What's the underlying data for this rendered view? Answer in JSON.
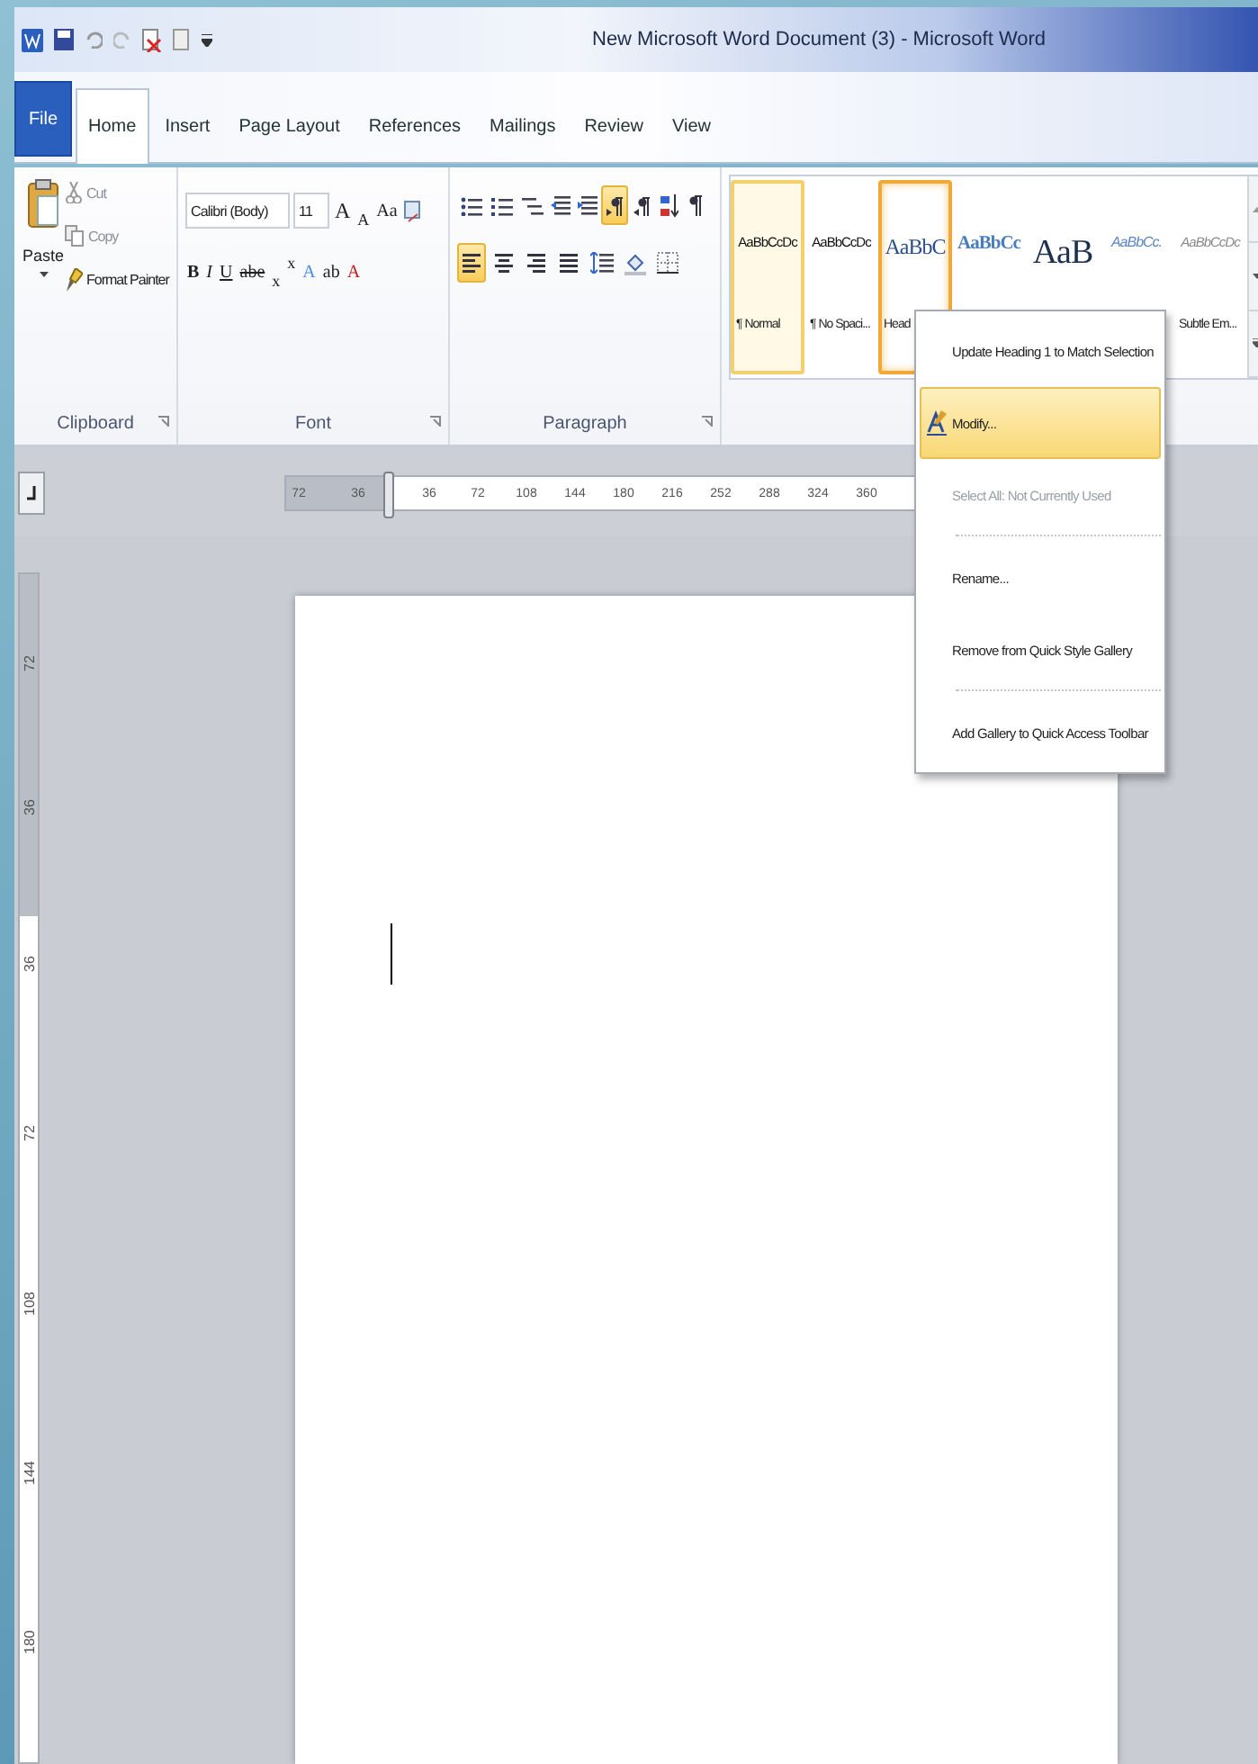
{
  "window": {
    "title": "New Microsoft Word Document (3) - Microsoft Word"
  },
  "tabs": [
    {
      "label": "File",
      "kind": "file",
      "selected": false
    },
    {
      "label": "Home",
      "kind": "tab",
      "selected": true
    },
    {
      "label": "Insert",
      "kind": "tab",
      "selected": false
    },
    {
      "label": "Page Layout",
      "kind": "tab",
      "selected": false
    },
    {
      "label": "References",
      "kind": "tab",
      "selected": false
    },
    {
      "label": "Mailings",
      "kind": "tab",
      "selected": false
    },
    {
      "label": "Review",
      "kind": "tab",
      "selected": false
    },
    {
      "label": "View",
      "kind": "tab",
      "selected": false
    }
  ],
  "clipboard": {
    "label": "Clipboard",
    "paste": "Paste",
    "cut": "Cut",
    "copy": "Copy",
    "format_painter": "Format Painter"
  },
  "font": {
    "label": "Font",
    "font_name": "Calibri (Body)",
    "font_size": "11",
    "row1_buttons": [
      {
        "glyph": "A",
        "kind": "grow"
      },
      {
        "glyph": "A",
        "kind": "shrink"
      },
      {
        "glyph": "Aa",
        "kind": "case"
      }
    ],
    "row2_buttons": [
      {
        "glyph": "B",
        "kind": "bold"
      },
      {
        "glyph": "I",
        "kind": "italic"
      },
      {
        "glyph": "U",
        "kind": "underline"
      },
      {
        "glyph": "abe",
        "kind": "strike"
      },
      {
        "glyph": "x",
        "kind": "sub"
      },
      {
        "glyph": "x",
        "kind": "super"
      },
      {
        "glyph": "A",
        "kind": "effects"
      },
      {
        "glyph": "ab",
        "kind": "highlight"
      },
      {
        "glyph": "A",
        "kind": "color"
      }
    ]
  },
  "paragraph": {
    "label": "Paragraph",
    "direction": [
      {
        "selected": true
      },
      {
        "selected": false
      }
    ],
    "alignment": [
      {
        "selected": true
      },
      {
        "selected": false
      },
      {
        "selected": false
      },
      {
        "selected": false
      }
    ]
  },
  "styles": [
    {
      "preview": "AaBbCcDc",
      "name": "¶ Normal",
      "kind": "normal",
      "selected": true,
      "focused": false
    },
    {
      "preview": "AaBbCcDc",
      "name": "¶ No Spaci...",
      "kind": "normal",
      "selected": false,
      "focused": false
    },
    {
      "preview": "AaBbC",
      "name": "Head",
      "kind": "heading",
      "selected": false,
      "focused": true
    },
    {
      "preview": "AaBbCc",
      "kind": "heading2",
      "selected": false,
      "focused": false
    },
    {
      "preview": "AaB",
      "kind": "title",
      "selected": false,
      "focused": false
    },
    {
      "preview": "AaBbCc.",
      "kind": "subtitle",
      "selected": false,
      "focused": false
    },
    {
      "preview": "AaBbCcDc",
      "name": "Subtle Em...",
      "kind": "subtle",
      "selected": false,
      "focused": false
    }
  ],
  "ruler": {
    "marks": [
      "72",
      "36",
      "36",
      "72",
      "108",
      "144",
      "180",
      "216",
      "252",
      "288",
      "324",
      "360"
    ]
  },
  "vertical_ruler": {
    "marks": [
      "72",
      "36",
      "36",
      "72",
      "108",
      "144",
      "180"
    ]
  },
  "context_menu": [
    {
      "kind": "item",
      "label": "Update Heading 1 to Match Selection",
      "selected": false,
      "disabled": false
    },
    {
      "kind": "item",
      "label": "Modify...",
      "selected": true,
      "disabled": false,
      "icon": true
    },
    {
      "kind": "item",
      "label": "Select All: Not Currently Used",
      "selected": false,
      "disabled": true
    },
    {
      "kind": "separator"
    },
    {
      "kind": "item",
      "label": "Rename...",
      "selected": false,
      "disabled": false
    },
    {
      "kind": "item",
      "label": "Remove from Quick Style Gallery",
      "selected": false,
      "disabled": false
    },
    {
      "kind": "separator"
    },
    {
      "kind": "item",
      "label": "Add Gallery to Quick Access Toolbar",
      "selected": false,
      "disabled": false
    }
  ]
}
